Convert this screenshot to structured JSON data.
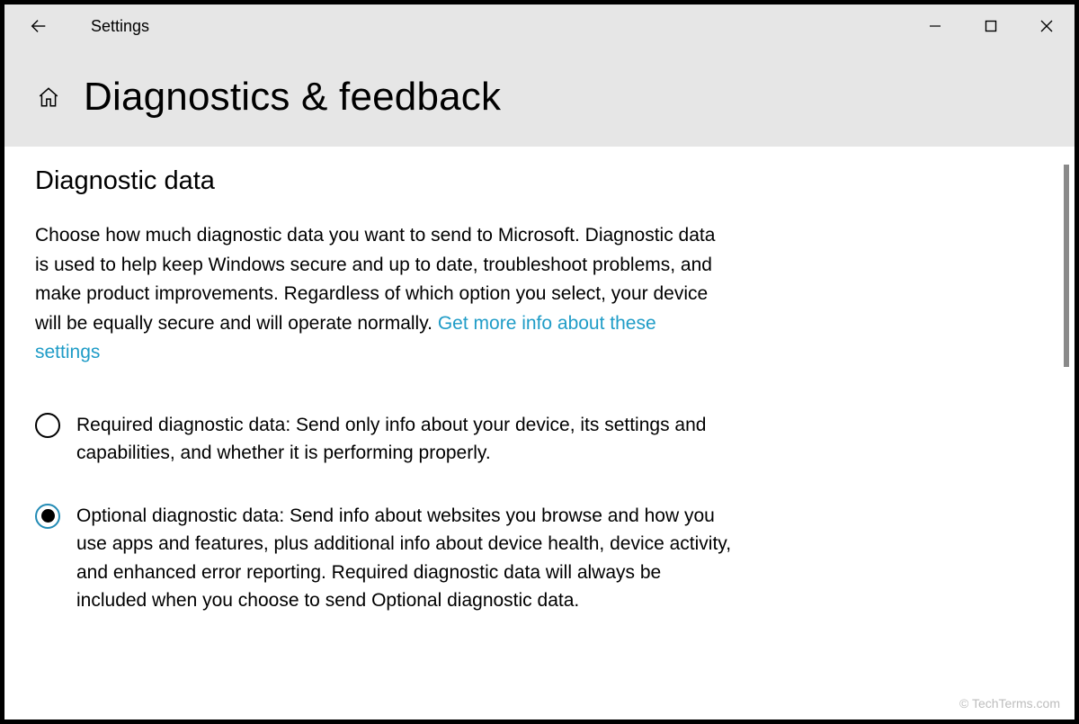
{
  "titlebar": {
    "title": "Settings"
  },
  "page": {
    "title": "Diagnostics & feedback"
  },
  "section": {
    "heading": "Diagnostic data",
    "description": "Choose how much diagnostic data you want to send to Microsoft. Diagnostic data is used to help keep Windows secure and up to date, troubleshoot problems, and make product improvements. Regardless of which option you select, your device will be equally secure and will operate normally. ",
    "link": "Get more info about these settings"
  },
  "options": [
    {
      "label": "Required diagnostic data: Send only info about your device, its settings and capabilities, and whether it is performing properly.",
      "selected": false
    },
    {
      "label": "Optional diagnostic data: Send info about websites you browse and how you use apps and features, plus additional info about device health, device activity, and enhanced error reporting. Required diagnostic data will always be included when you choose to send Optional diagnostic data.",
      "selected": true
    }
  ],
  "watermark": "© TechTerms.com"
}
